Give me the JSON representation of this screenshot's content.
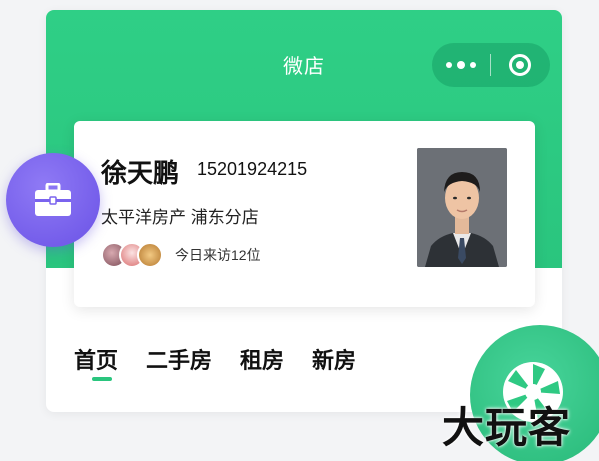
{
  "header": {
    "title": "微店",
    "more_icon": "more-dots-icon",
    "close_icon": "target-close-icon",
    "accent_color": "#2ac57e"
  },
  "profile": {
    "name": "徐天鹏",
    "phone": "15201924215",
    "company": "太平洋房产 浦东分店",
    "visitors_text": "今日来访12位",
    "photo_icon": "agent-portrait"
  },
  "tabs": [
    {
      "label": "首页",
      "active": true
    },
    {
      "label": "二手房",
      "active": false
    },
    {
      "label": "租房",
      "active": false
    },
    {
      "label": "新房",
      "active": false
    }
  ],
  "badges": {
    "left_icon": "suitcase-icon",
    "left_color": "#6f58e9",
    "right_icon": "aperture-icon",
    "right_color": "#2fc983"
  },
  "watermark": {
    "text": "大玩客"
  }
}
